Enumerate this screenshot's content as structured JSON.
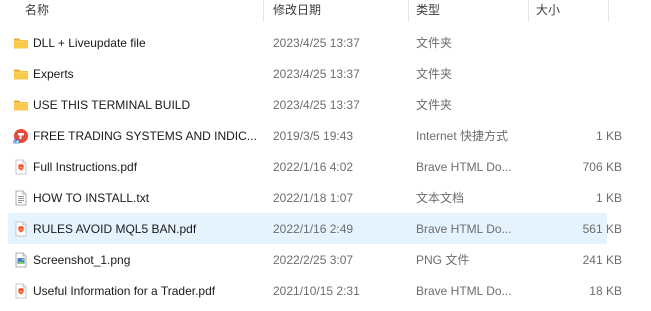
{
  "columns": {
    "name": "名称",
    "date": "修改日期",
    "type": "类型",
    "size": "大小"
  },
  "files": [
    {
      "icon": "folder-icon",
      "name": "DLL + Liveupdate file",
      "date": "2023/4/25 13:37",
      "type": "文件夹",
      "size": ""
    },
    {
      "icon": "folder-icon",
      "name": "Experts",
      "date": "2023/4/25 13:37",
      "type": "文件夹",
      "size": ""
    },
    {
      "icon": "folder-icon",
      "name": "USE THIS TERMINAL BUILD",
      "date": "2023/4/25 13:37",
      "type": "文件夹",
      "size": ""
    },
    {
      "icon": "internet-shortcut-icon",
      "name": "FREE TRADING SYSTEMS AND INDIC...",
      "date": "2019/3/5 19:43",
      "type": "Internet 快捷方式",
      "size": "1 KB"
    },
    {
      "icon": "brave-pdf-icon",
      "name": "Full Instructions.pdf",
      "date": "2022/1/16 4:02",
      "type": "Brave HTML Do...",
      "size": "706 KB"
    },
    {
      "icon": "text-file-icon",
      "name": "HOW TO INSTALL.txt",
      "date": "2022/1/18 1:07",
      "type": "文本文档",
      "size": "1 KB"
    },
    {
      "icon": "brave-pdf-icon",
      "name": "RULES AVOID MQL5 BAN.pdf",
      "date": "2022/1/16 2:49",
      "type": "Brave HTML Do...",
      "size": "561 KB"
    },
    {
      "icon": "png-image-icon",
      "name": "Screenshot_1.png",
      "date": "2022/2/25 3:07",
      "type": "PNG 文件",
      "size": "241 KB"
    },
    {
      "icon": "brave-pdf-icon",
      "name": "Useful Information for a Trader.pdf",
      "date": "2021/10/15 2:31",
      "type": "Brave HTML Do...",
      "size": "18 KB"
    }
  ],
  "selected_row": "RULES AVOID MQL5 BAN.pdf",
  "colors": {
    "selection": "#e5f3ff",
    "folder": "#f5c344",
    "brave": "#e8472b"
  }
}
